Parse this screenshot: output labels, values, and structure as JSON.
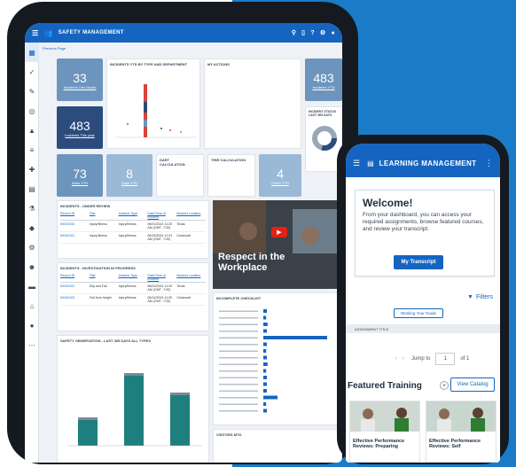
{
  "safety": {
    "title": "SAFETY MANAGEMENT",
    "crumb": "Previous Page",
    "kpis": [
      {
        "number": "33",
        "label": "Incidents This Month"
      },
      {
        "number": "483",
        "label": "Incidents This year"
      },
      {
        "number": "73",
        "label": "Visits YTD"
      },
      {
        "number": "8",
        "label": "Days YTD"
      },
      {
        "number": "4",
        "label": "OWIS YTD"
      },
      {
        "number": "483",
        "label": "Incidents YTD"
      }
    ],
    "panels": {
      "incidents_type": "INCIDENTS YTD BY TYPE AND DEPARTMENT",
      "my_actions": "MY ACTIONS",
      "status": "INCIDENT STATUS LAST 365 DAYS",
      "under_review": "INCIDENTS - UNDER REVIEW",
      "in_progress": "INCIDENTS - INVESTIGATION IN PROGRESS",
      "observations": "SAFETY OBSERVATION - LAST 365 DAYS ALL TYPES",
      "checklist": "INCOMPLETE CHECKLIST",
      "visitors": "VISITORS MTD",
      "dart": "DART CALCULATION",
      "trir": "TRIR CALCULATION"
    },
    "video_title": "Respect in the Workplace",
    "table_headers": [
      "Record ID",
      "Title",
      "Incident Type",
      "Date/Time of Incident",
      "Nearest Location"
    ],
    "review_rows": [
      [
        "INC00100",
        "Injury/Illness",
        "Injury/Illness",
        "06/01/2024 11:20 AM (GMT -7:00)",
        "Texas"
      ],
      [
        "INC00101",
        "Injury/Illness",
        "Injury/Illness",
        "06/15/2024 11:24 AM (GMT -7:00)",
        "Cincinnati"
      ]
    ],
    "progress_rows": [
      [
        "INC00102",
        "Slip and Fall",
        "Injury/Illness",
        "06/01/2024 11:20 AM (GMT -7:00)",
        "Texas"
      ],
      [
        "INC00103",
        "Fall from height",
        "Injury/Illness",
        "06/14/2024 11:20 AM (GMT -7:00)",
        "Cincinnati"
      ]
    ],
    "bar_values": [
      0.32,
      0.82,
      0.6
    ],
    "checklist_values": [
      0.05,
      0.04,
      0.06,
      0.05,
      0.9,
      0.05,
      0.04,
      0.05,
      0.06,
      0.04,
      0.05,
      0.05,
      0.05,
      0.2,
      0.04,
      0.05
    ]
  },
  "learning": {
    "title": "LEARNING MANAGEMENT",
    "welcome_title": "Welcome!",
    "welcome_text": "From your dashboard, you can access your required assignments, browse featured courses, and review your transcript.",
    "transcript_button": "My Transcript",
    "filters": "Filters",
    "guide_button": "Working Your Guide",
    "assignment_title": "ASSIGNMENT TITLE",
    "jump_label": "Jump to",
    "page_value": "1",
    "page_total": "of 1",
    "featured": "Featured Training",
    "catalog_button": "View Catalog",
    "courses": [
      "Effective Performance Reviews: Preparing",
      "Effective Performance Reviews: Self"
    ]
  },
  "colors": {
    "brand": "#1565c0",
    "teal": "#1f7f7f"
  }
}
